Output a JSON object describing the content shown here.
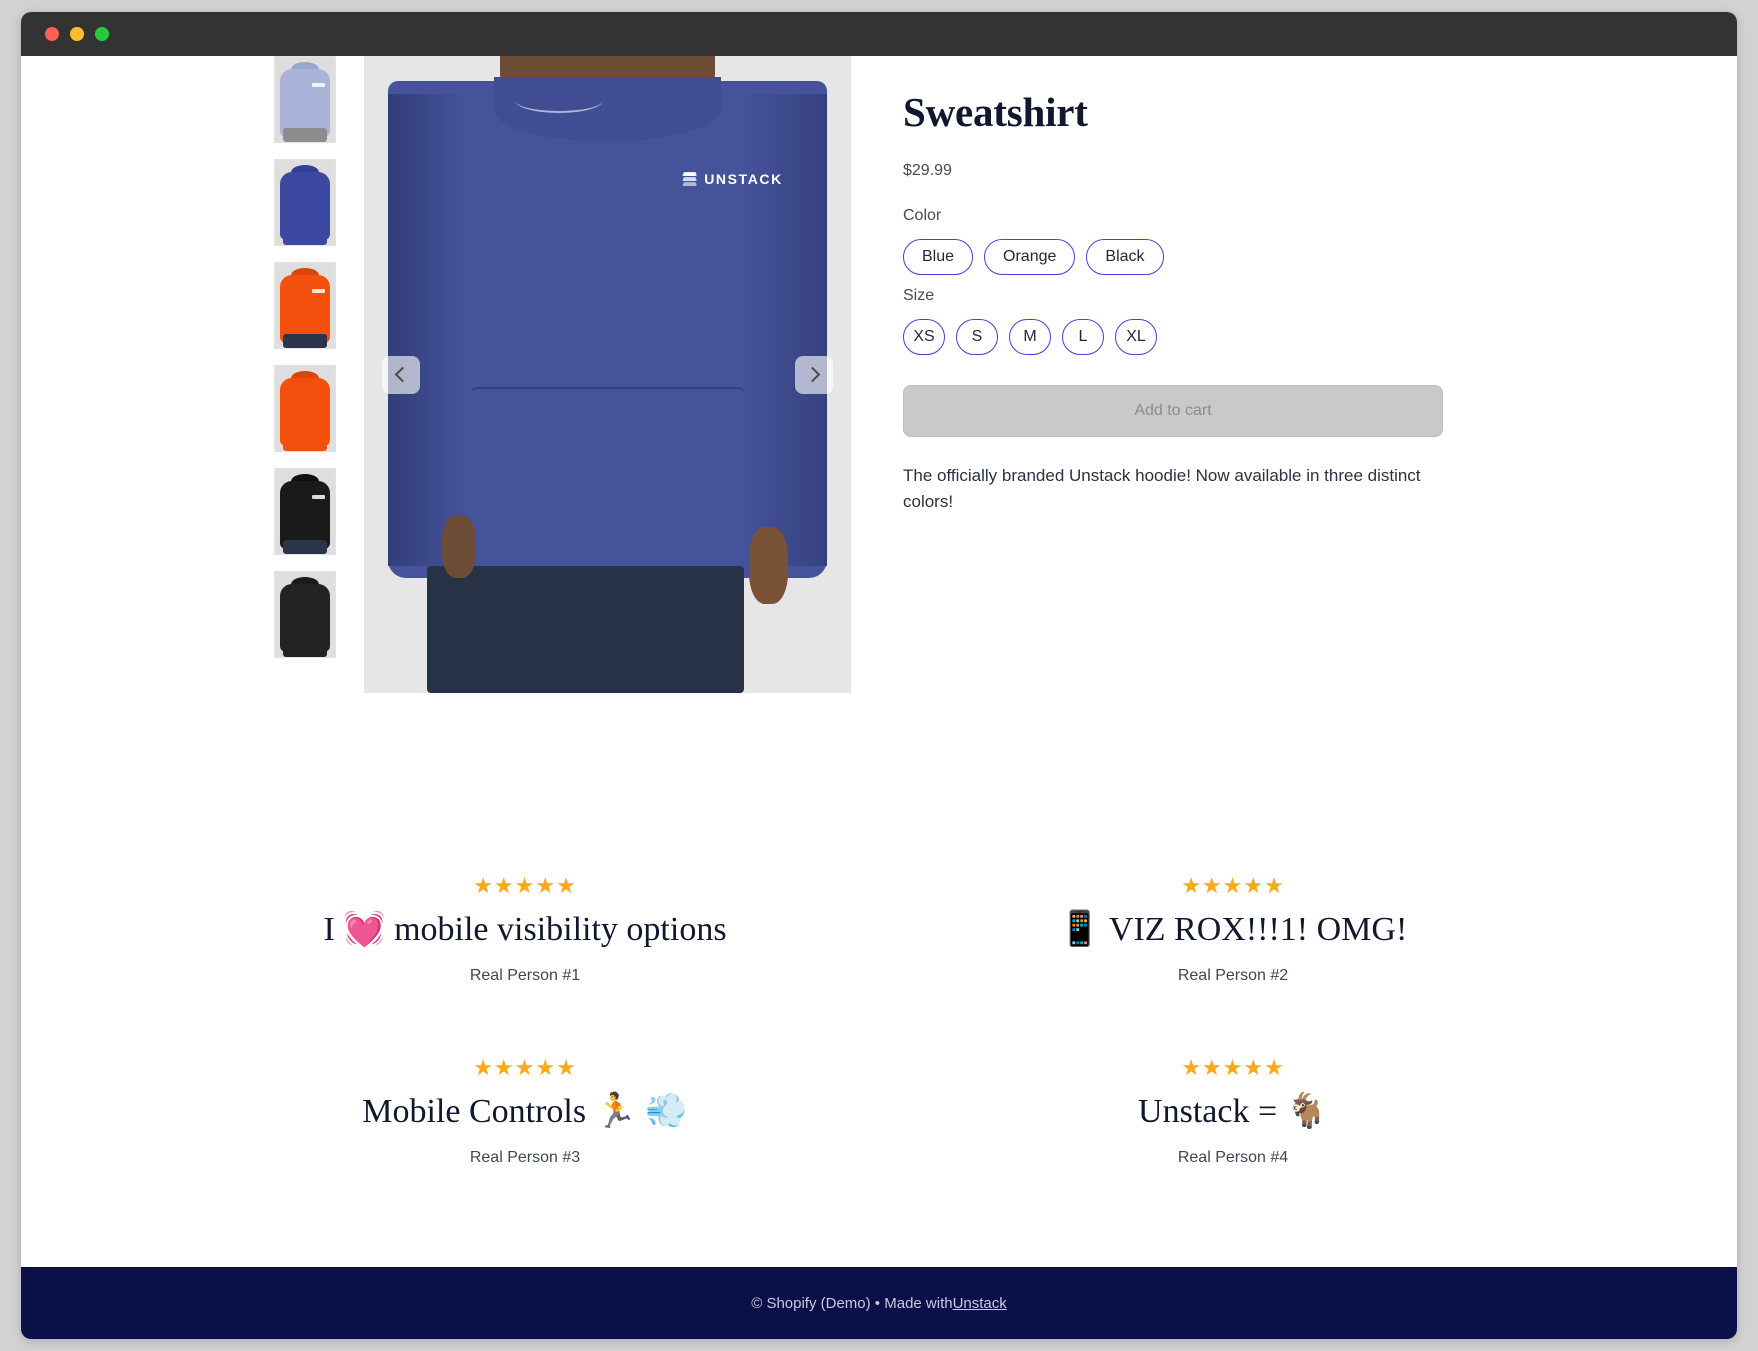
{
  "window": {
    "traffic_lights": [
      "close",
      "minimize",
      "maximize"
    ]
  },
  "product": {
    "title": "Sweatshirt",
    "price": "$29.99",
    "brand_mark": "UNSTACK",
    "options": [
      {
        "label": "Color",
        "values": [
          "Blue",
          "Orange",
          "Black"
        ]
      },
      {
        "label": "Size",
        "values": [
          "XS",
          "S",
          "M",
          "L",
          "XL"
        ]
      }
    ],
    "add_to_cart_label": "Add to cart",
    "description": "The officially branded Unstack hoodie! Now available in three distinct colors!",
    "gallery": {
      "prev_label": "Previous image",
      "next_label": "Next image",
      "thumbnails": [
        {
          "name": "light-blue-hoodie-front",
          "color": "#aab4d8",
          "pants": "#8c8c8c",
          "logo": true
        },
        {
          "name": "blue-hoodie-back",
          "color": "#3b49a0",
          "pants": "#3b49a0",
          "logo": false
        },
        {
          "name": "orange-hoodie-front",
          "color": "#f4500d",
          "pants": "#2b3448",
          "logo": true
        },
        {
          "name": "orange-hoodie-back",
          "color": "#f4500d",
          "pants": "#f4500d",
          "logo": false
        },
        {
          "name": "black-hoodie-front",
          "color": "#1a1a1a",
          "pants": "#2b3448",
          "logo": true
        },
        {
          "name": "black-hoodie-back",
          "color": "#232323",
          "pants": "#232323",
          "logo": false
        }
      ]
    }
  },
  "reviews": [
    {
      "stars": "★★★★★",
      "rating": 5,
      "text": "I 💓 mobile visibility options",
      "author": "Real Person #1"
    },
    {
      "stars": "★★★★★",
      "rating": 5,
      "text": "📱 VIZ ROX!!!1! OMG!",
      "author": "Real Person #2"
    },
    {
      "stars": "★★★★★",
      "rating": 5,
      "text": "Mobile Controls 🏃 💨",
      "author": "Real Person #3"
    },
    {
      "stars": "★★★★★",
      "rating": 5,
      "text": "Unstack = 🐐",
      "author": "Real Person #4"
    }
  ],
  "footer": {
    "prefix": "© Shopify (Demo) • Made with ",
    "link": "Unstack"
  },
  "colors": {
    "accent": "#4540d8",
    "star": "#fba919",
    "footer_bg": "#0b1048",
    "titlebar": "#333333",
    "page_bg": "#d2d2d2"
  }
}
